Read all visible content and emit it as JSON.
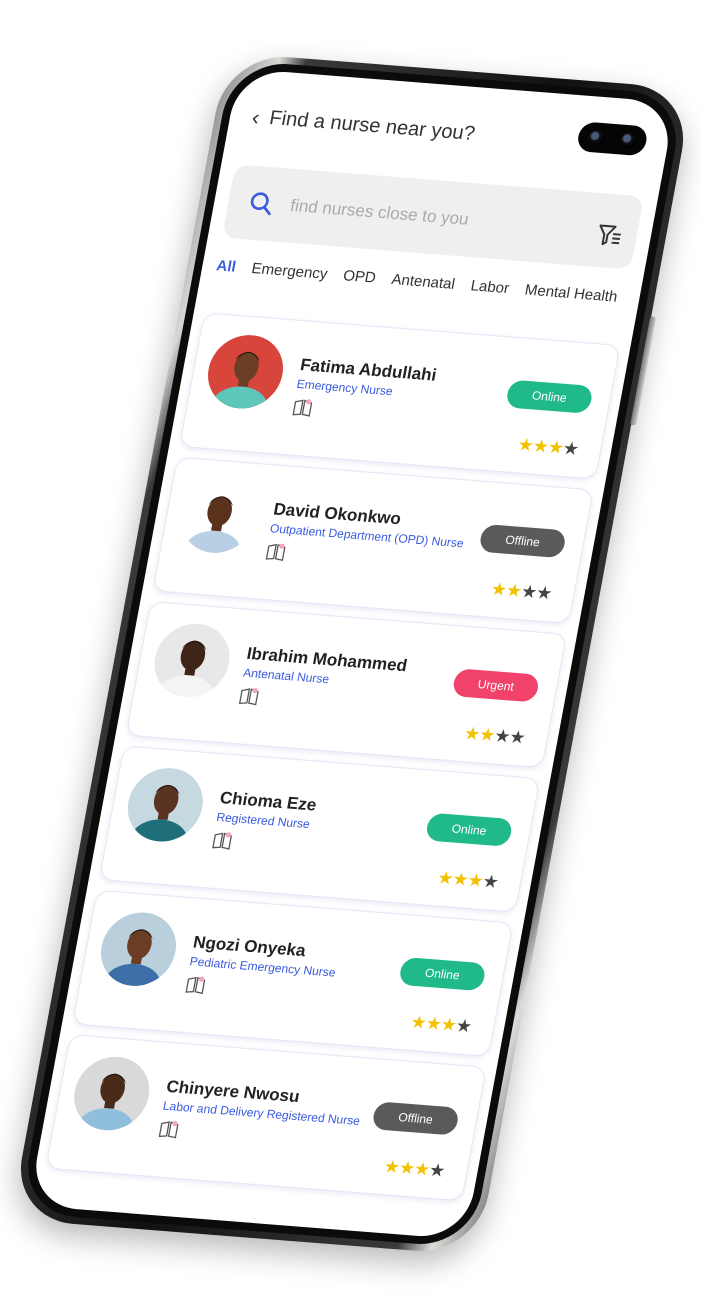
{
  "header": {
    "title": "Find a nurse near you?"
  },
  "search": {
    "placeholder": "find nurses close to you"
  },
  "tabs": [
    {
      "label": "All",
      "active": true
    },
    {
      "label": "Emergency",
      "active": false
    },
    {
      "label": "OPD",
      "active": false
    },
    {
      "label": "Antenatal",
      "active": false
    },
    {
      "label": "Labor",
      "active": false
    },
    {
      "label": "Mental Health",
      "active": false
    }
  ],
  "colors": {
    "accent": "#3a5be0",
    "online": "#1fb98a",
    "offline": "#5a5a5a",
    "urgent": "#f0426a",
    "star": "#f2c200"
  },
  "nurses": [
    {
      "name": "Fatima Abdullahi",
      "role": "Emergency Nurse",
      "status": "Online",
      "status_color": "#1fb98a",
      "rating": 3,
      "max_rating": 4,
      "avatar_bg": "#d8453a",
      "skin": "#6b3e26",
      "top_color": "#5fc6bc"
    },
    {
      "name": "David Okonkwo",
      "role": "Outpatient Department (OPD) Nurse",
      "status": "Offline",
      "status_color": "#5a5a5a",
      "rating": 2,
      "max_rating": 4,
      "avatar_bg": "#ffffff",
      "skin": "#5a321c",
      "top_color": "#b9cfe4"
    },
    {
      "name": "Ibrahim Mohammed",
      "role": "Antenatal Nurse",
      "status": "Urgent",
      "status_color": "#f0426a",
      "rating": 2,
      "max_rating": 4,
      "avatar_bg": "#e8e8e8",
      "skin": "#3e2416",
      "top_color": "#f4f4f4"
    },
    {
      "name": "Chioma Eze",
      "role": "Registered Nurse",
      "status": "Online",
      "status_color": "#1fb98a",
      "rating": 3,
      "max_rating": 4,
      "avatar_bg": "#c6d8e0",
      "skin": "#5a3420",
      "top_color": "#1e6f7a"
    },
    {
      "name": "Ngozi Onyeka",
      "role": "Pediatric Emergency Nurse",
      "status": "Online",
      "status_color": "#1fb98a",
      "rating": 3,
      "max_rating": 4,
      "avatar_bg": "#b9d0dc",
      "skin": "#6a3d24",
      "top_color": "#3c6fa8"
    },
    {
      "name": "Chinyere Nwosu",
      "role": "Labor and Delivery Registered Nurse",
      "status": "Offline",
      "status_color": "#5a5a5a",
      "rating": 3,
      "max_rating": 4,
      "avatar_bg": "#d9d9d9",
      "skin": "#4a2a18",
      "top_color": "#8fbfdc"
    }
  ]
}
